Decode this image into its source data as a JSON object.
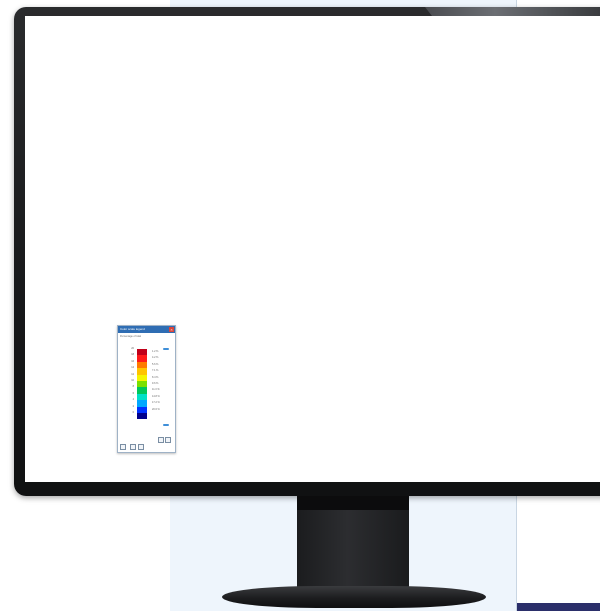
{
  "legend_dialog": {
    "title": "Color scale legend",
    "subtitle": "Percentage of total",
    "value_labels": [
      "20",
      "18",
      "16",
      "14",
      "12",
      "10",
      "8",
      "6",
      "4",
      "2",
      "0"
    ],
    "percent_labels": [
      "1.2 %",
      "4.2 %",
      "5.6 %",
      "7.1 %",
      "8.4 %",
      "9.6 %",
      "11.3 %",
      "14.8 %",
      "17.2 %",
      "20.6 %"
    ],
    "colors": [
      "#c0001a",
      "#ff1a1a",
      "#ff7a00",
      "#ffc400",
      "#f5f500",
      "#7be000",
      "#00c85a",
      "#00e0c8",
      "#00a8ff",
      "#0032ff",
      "#00008c"
    ]
  }
}
